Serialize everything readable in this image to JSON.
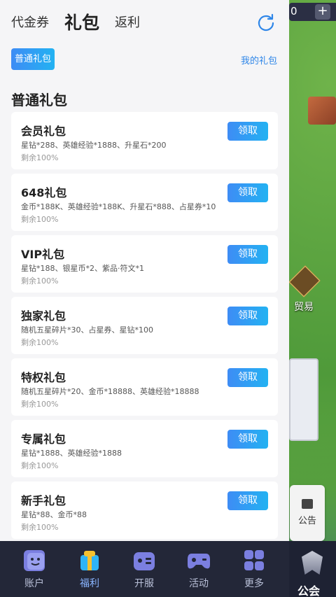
{
  "header": {
    "tabs": [
      {
        "label": "代金券"
      },
      {
        "label": "礼包"
      },
      {
        "label": "返利"
      }
    ],
    "active_tab": "礼包"
  },
  "filters": {
    "chip_label": "普通礼包",
    "my_gifts_label": "我的礼包"
  },
  "section": {
    "title": "普通礼包"
  },
  "gifts": [
    {
      "name": "会员礼包",
      "desc": "星钻*288、英雄经验*1888、升星石*200",
      "remain": "剩余100%",
      "button": "领取"
    },
    {
      "name": "648礼包",
      "desc": "金币*188K、英雄经验*188K、升星石*888、占星券*10",
      "remain": "剩余100%",
      "button": "领取"
    },
    {
      "name": "VIP礼包",
      "desc": "星钻*188、银星币*2、紫品·符文*1",
      "remain": "剩余100%",
      "button": "领取"
    },
    {
      "name": "独家礼包",
      "desc": "随机五星碎片*30、占星券、星钻*100",
      "remain": "剩余100%",
      "button": "领取"
    },
    {
      "name": "特权礼包",
      "desc": "随机五星碎片*20、金币*18888、英雄经验*18888",
      "remain": "剩余100%",
      "button": "领取"
    },
    {
      "name": "专属礼包",
      "desc": "星钻*1888、英雄经验*1888",
      "remain": "剩余100%",
      "button": "领取"
    },
    {
      "name": "新手礼包",
      "desc": "星钻*88、金币*88",
      "remain": "剩余100%",
      "button": "领取"
    }
  ],
  "nav": [
    {
      "label": "账户",
      "icon": "account-icon"
    },
    {
      "label": "福利",
      "icon": "gift-icon"
    },
    {
      "label": "开服",
      "icon": "server-icon"
    },
    {
      "label": "活动",
      "icon": "gamepad-icon"
    },
    {
      "label": "更多",
      "icon": "grid-icon"
    }
  ],
  "game": {
    "currency_value": "0",
    "plus_label": "+",
    "trade_label": "贸易",
    "announce_label": "公告",
    "guild_label": "公会"
  },
  "colors": {
    "accent": "#2e86e8",
    "nav_bg": "#232738",
    "nav_icon": "#7b7fe0"
  }
}
